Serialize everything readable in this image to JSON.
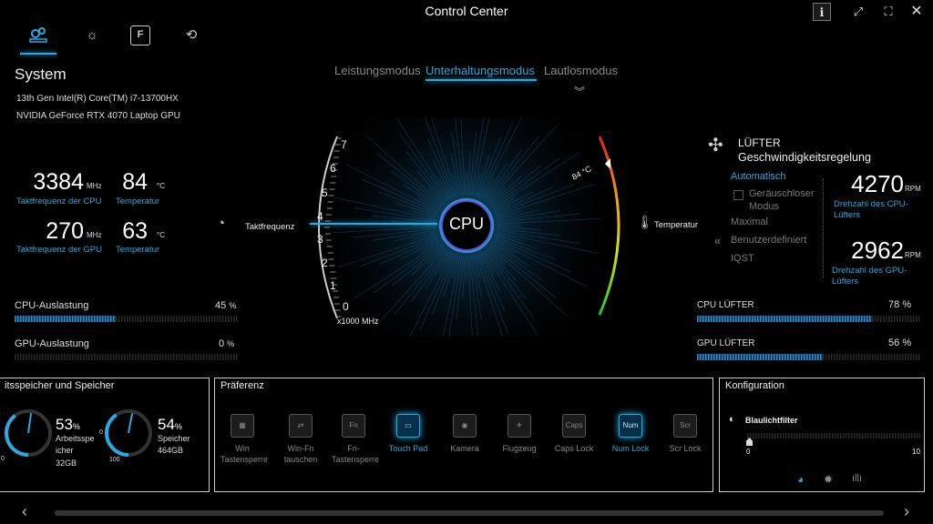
{
  "window": {
    "title": "Control Center",
    "buttons": [
      "info",
      "restore",
      "fullscreen",
      "close"
    ]
  },
  "tabs": [
    {
      "icon": "gears-icon",
      "active": true
    },
    {
      "icon": "brightness-icon",
      "active": false
    },
    {
      "icon": "fn-key-icon",
      "label": "F",
      "active": false
    },
    {
      "icon": "connection-icon",
      "active": false
    }
  ],
  "system": {
    "title": "System",
    "cpu_name": "13th Gen Intel(R) Core(TM) i7-13700HX",
    "gpu_name": "NVIDIA GeForce RTX 4070 Laptop GPU",
    "cpu_freq": {
      "value": "3384",
      "unit": "MHz",
      "label": "Taktfrequenz der CPU"
    },
    "cpu_temp": {
      "value": "84",
      "unit": "°C",
      "label": "Temperatur"
    },
    "gpu_freq": {
      "value": "270",
      "unit": "MHz",
      "label": "Taktfrequenz der GPU"
    },
    "gpu_temp": {
      "value": "63",
      "unit": "°C",
      "label": "Temperatur"
    },
    "cpu_load": {
      "label": "CPU-Auslastung",
      "value": 45,
      "text": "45",
      "unit": "%"
    },
    "gpu_load": {
      "label": "GPU-Auslastung",
      "value": 0,
      "text": "0",
      "unit": "%"
    }
  },
  "modes": {
    "items": [
      "Leistungsmodus",
      "Unterhaltungsmodus",
      "Lautlosmodus"
    ],
    "active": "Unterhaltungsmodus"
  },
  "gauge": {
    "center_label": "CPU",
    "freq_label": "Taktfrequenz",
    "temp_label": "Temperatur",
    "scale_ticks": [
      "7",
      "6",
      "5",
      "4",
      "3",
      "2",
      "1",
      "0"
    ],
    "scale_unit": "x1000 MHz",
    "temp_reading": "84 °C"
  },
  "fan": {
    "title": "LÜFTER",
    "subtitle": "Geschwindigkeitsregelung",
    "options": {
      "automatic": "Automatisch",
      "quiet": "Geräuschloser Modus",
      "max": "Maximal",
      "custom": "Benutzerdefiniert",
      "iqst": "IQST"
    },
    "cpu_rpm": {
      "value": "4270",
      "unit": "RPM",
      "label": "Drehzahl des CPU-Lüfters"
    },
    "gpu_rpm": {
      "value": "2962",
      "unit": "RPM",
      "label": "Drehzahl des GPU-Lüfters"
    },
    "cpu_fan": {
      "label": "CPU LÜFTER",
      "value": 78,
      "text": "78",
      "unit": "%"
    },
    "gpu_fan": {
      "label": "GPU LÜFTER",
      "value": 56,
      "text": "56",
      "unit": "%"
    }
  },
  "memory": {
    "title": "itsspeicher und Speicher",
    "ram": {
      "percent": "53",
      "unit": "%",
      "label1": "Arbeitsspe",
      "label2": "icher",
      "size": "32GB",
      "fraction": 0.53,
      "scale_min": "0"
    },
    "storage": {
      "percent": "54",
      "unit": "%",
      "label": "Speicher",
      "size": "464GB",
      "fraction": 0.54,
      "scale_min": "0",
      "scale_max": "100"
    }
  },
  "preference": {
    "title": "Präferenz",
    "buttons": [
      {
        "icon": "win-key-icon",
        "glyph": "▦",
        "label1": "Win",
        "label2": "Tastensperre",
        "on": false
      },
      {
        "icon": "win-fn-swap-icon",
        "glyph": "⇄",
        "label1": "Win-Fn",
        "label2": "tauschen",
        "on": false
      },
      {
        "icon": "fn-lock-icon",
        "glyph": "Fn",
        "label1": "Fn-",
        "label2": "Tastensperre",
        "on": false
      },
      {
        "icon": "touchpad-icon",
        "glyph": "▭",
        "label1": "Touch Pad",
        "label2": "",
        "on": true
      },
      {
        "icon": "camera-icon",
        "glyph": "◉",
        "label1": "Kamera",
        "label2": "",
        "on": false
      },
      {
        "icon": "airplane-icon",
        "glyph": "✈",
        "label1": "Flugzeug",
        "label2": "",
        "on": false
      },
      {
        "icon": "caps-lock-icon",
        "glyph": "Caps",
        "label1": "Caps Lock",
        "label2": "",
        "on": false
      },
      {
        "icon": "num-lock-icon",
        "glyph": "Num",
        "label1": "Num Lock",
        "label2": "",
        "on": true
      },
      {
        "icon": "scroll-lock-icon",
        "glyph": "Scr",
        "label1": "Scr Lock",
        "label2": "",
        "on": false
      }
    ]
  },
  "config": {
    "title": "Konfiguration",
    "bluelight_label": "Blaulichtfilter",
    "slider_min": "0",
    "slider_max": "10",
    "slider_value": 0
  },
  "colors": {
    "accent": "#2aa9e0",
    "background": "#000000"
  }
}
